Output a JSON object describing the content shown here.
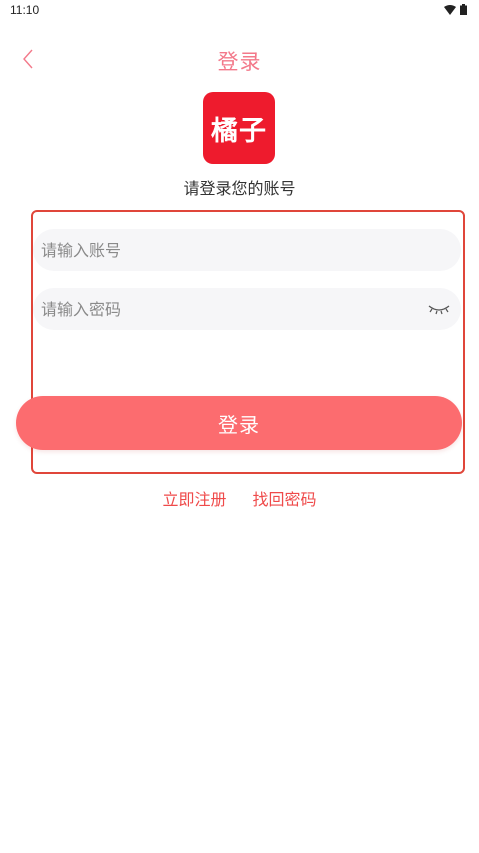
{
  "status_bar": {
    "time": "11:10",
    "icons": [
      "wifi-icon",
      "battery-icon"
    ]
  },
  "nav": {
    "back_icon": "chevron-left-icon",
    "title": "登录"
  },
  "logo": {
    "text": "橘子"
  },
  "subtitle": "请登录您的账号",
  "form": {
    "account": {
      "placeholder": "请输入账号",
      "value": ""
    },
    "password": {
      "placeholder": "请输入密码",
      "value": "",
      "toggle_icon": "eye-closed-icon"
    },
    "login_label": "登录"
  },
  "links": {
    "register": "立即注册",
    "forgot": "找回密码"
  },
  "colors": {
    "accent": "#f3798a",
    "button": "#fc6c6f",
    "link": "#ef4a4a",
    "logo_bg": "#ee1b2d",
    "highlight_border": "#e0463a"
  }
}
